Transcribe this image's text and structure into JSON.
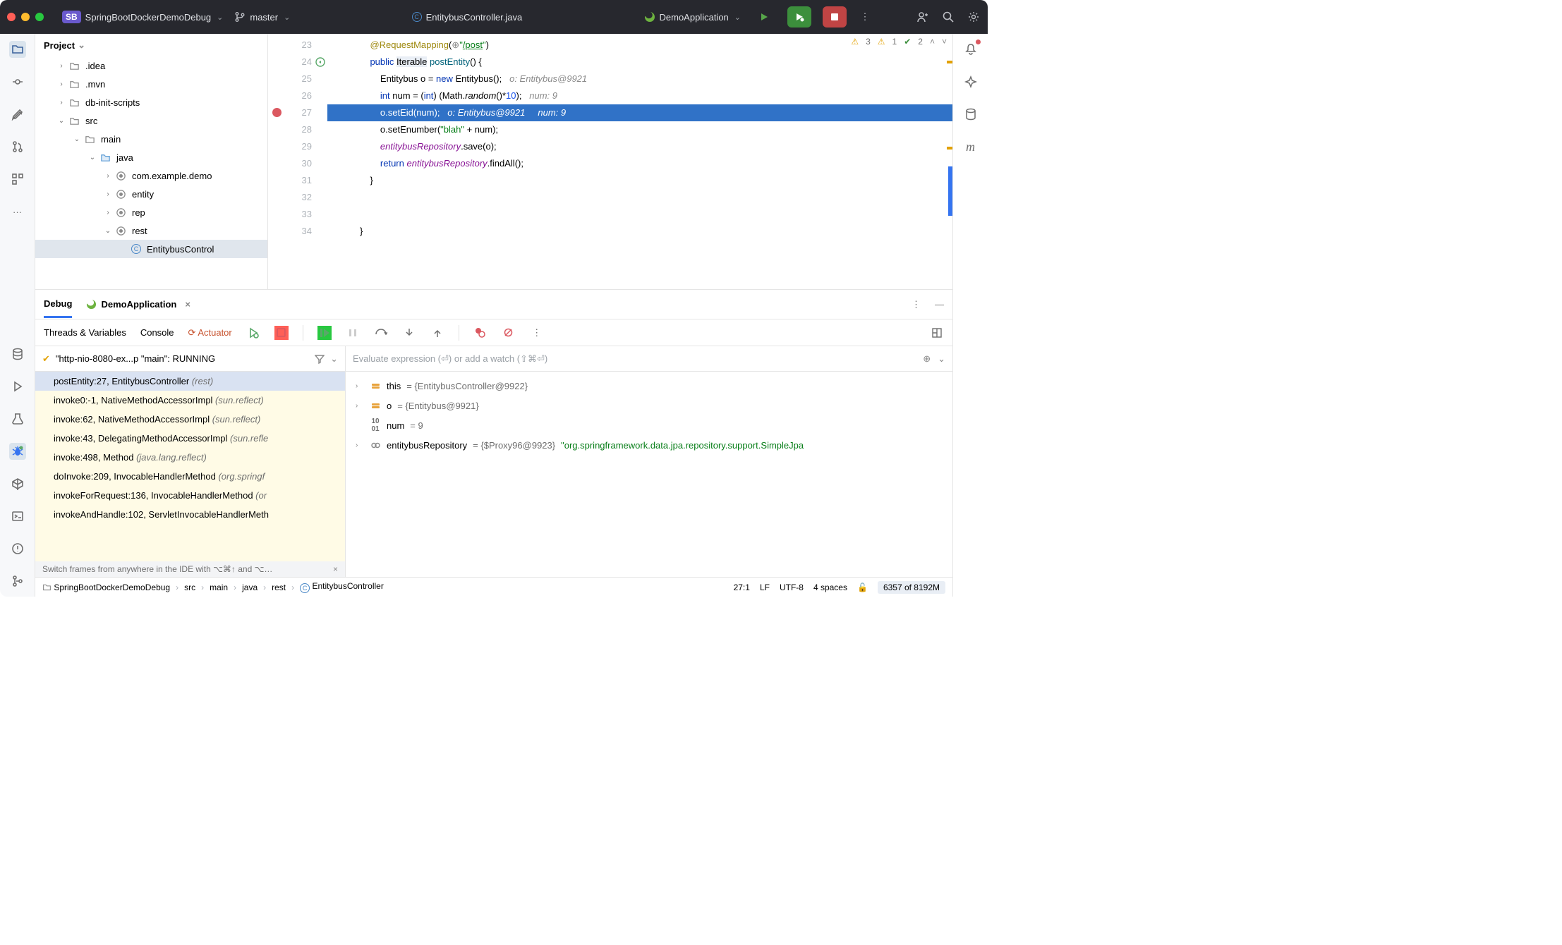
{
  "titlebar": {
    "project_name": "SpringBootDockerDemoDebug",
    "branch": "master",
    "open_file": "EntitybusController.java",
    "run_config": "DemoApplication",
    "project_badge": "SB"
  },
  "project_pane": {
    "title": "Project",
    "tree": [
      {
        "depth": 1,
        "expand": "›",
        "icon": "folder",
        "label": ".idea"
      },
      {
        "depth": 1,
        "expand": "›",
        "icon": "folder",
        "label": ".mvn"
      },
      {
        "depth": 1,
        "expand": "›",
        "icon": "folder",
        "label": "db-init-scripts"
      },
      {
        "depth": 1,
        "expand": "⌄",
        "icon": "folder",
        "label": "src"
      },
      {
        "depth": 2,
        "expand": "⌄",
        "icon": "folder",
        "label": "main"
      },
      {
        "depth": 3,
        "expand": "⌄",
        "icon": "folder-blue",
        "label": "java"
      },
      {
        "depth": 4,
        "expand": "›",
        "icon": "package",
        "label": "com.example.demo"
      },
      {
        "depth": 4,
        "expand": "›",
        "icon": "package",
        "label": "entity"
      },
      {
        "depth": 4,
        "expand": "›",
        "icon": "package",
        "label": "rep"
      },
      {
        "depth": 4,
        "expand": "⌄",
        "icon": "package",
        "label": "rest"
      },
      {
        "depth": 5,
        "expand": "",
        "icon": "class",
        "label": "EntitybusControl",
        "selected": true
      }
    ]
  },
  "editor": {
    "lines": [
      {
        "n": 23,
        "html": "@RequestMapping(⊕\"<u>/post</u>\")",
        "pad": 1,
        "ann": true
      },
      {
        "n": 24,
        "html": "<span class='kw'>public</span> <span class='hi'>Iterable</span> <span class='fn'>postEntity</span>() {",
        "pad": 1,
        "marker": "gutter-impl"
      },
      {
        "n": 25,
        "html": "Entitybus o = <span class='kw'>new</span> Entitybus();   <span class='hint'>o: Entitybus@9921</span>",
        "pad": 2
      },
      {
        "n": 26,
        "html": "<span class='kw'>int</span> num = (<span class='kw'>int</span>) (Math.<span style='font-style:italic'>random</span>()*<span class='num'>10</span>);   <span class='hint'>num: 9</span>",
        "pad": 2
      },
      {
        "n": 27,
        "html": "o.setEid(num);   <span class='hint'>o: Entitybus@9921     num: 9</span>",
        "pad": 2,
        "current": true,
        "breakpoint": true
      },
      {
        "n": 28,
        "html": "o.setEnumber(<span class='str'>\"blah\"</span> + num);",
        "pad": 2
      },
      {
        "n": 29,
        "html": "<span class='fld'>entitybusRepository</span>.save(o);",
        "pad": 2
      },
      {
        "n": 30,
        "html": "<span class='kw'>return</span> <span class='fld'>entitybusRepository</span>.findAll();",
        "pad": 2
      },
      {
        "n": 31,
        "html": "}",
        "pad": 1
      },
      {
        "n": 32,
        "html": "",
        "pad": 0
      },
      {
        "n": 33,
        "html": "",
        "pad": 0
      },
      {
        "n": 34,
        "html": "}",
        "pad": 0
      }
    ],
    "analysis": {
      "warn_high": "3",
      "warn_low": "1",
      "typo": "2"
    }
  },
  "debug": {
    "tab_label": "Debug",
    "run_tab": "DemoApplication",
    "toolbar_tabs": [
      "Threads & Variables",
      "Console",
      "Actuator"
    ],
    "thread_status": "\"http-nio-8080-ex...p \"main\": RUNNING",
    "frames": [
      {
        "text": "postEntity:27, EntitybusController",
        "pkg": "(rest)",
        "top": true
      },
      {
        "text": "invoke0:-1, NativeMethodAccessorImpl",
        "pkg": "(sun.reflect)"
      },
      {
        "text": "invoke:62, NativeMethodAccessorImpl",
        "pkg": "(sun.reflect)"
      },
      {
        "text": "invoke:43, DelegatingMethodAccessorImpl",
        "pkg": "(sun.refle"
      },
      {
        "text": "invoke:498, Method",
        "pkg": "(java.lang.reflect)"
      },
      {
        "text": "doInvoke:209, InvocableHandlerMethod",
        "pkg": "(org.springf"
      },
      {
        "text": "invokeForRequest:136, InvocableHandlerMethod",
        "pkg": "(or"
      },
      {
        "text": "invokeAndHandle:102, ServletInvocableHandlerMeth",
        "pkg": ""
      }
    ],
    "eval_placeholder": "Evaluate expression (⏎) or add a watch (⇧⌘⏎)",
    "variables": [
      {
        "expand": "›",
        "icon": "obj",
        "name": "this",
        "val": "= {EntitybusController@9922}"
      },
      {
        "expand": "›",
        "icon": "obj",
        "name": "o",
        "val": "= {Entitybus@9921}"
      },
      {
        "expand": "",
        "icon": "prim",
        "name": "num",
        "val": "= 9"
      },
      {
        "expand": "›",
        "icon": "link",
        "name": "entitybusRepository",
        "val": "= {$Proxy96@9923}",
        "str": "\"org.springframework.data.jpa.repository.support.SimpleJpa"
      }
    ],
    "hint_text": "Switch frames from anywhere in the IDE with ⌥⌘↑ and ⌥…"
  },
  "statusbar": {
    "breadcrumbs": [
      "SpringBootDockerDemoDebug",
      "src",
      "main",
      "java",
      "rest",
      "EntitybusController"
    ],
    "cursor": "27:1",
    "line_sep": "LF",
    "encoding": "UTF-8",
    "indent": "4 spaces",
    "memory": "6357 of 8192M"
  }
}
